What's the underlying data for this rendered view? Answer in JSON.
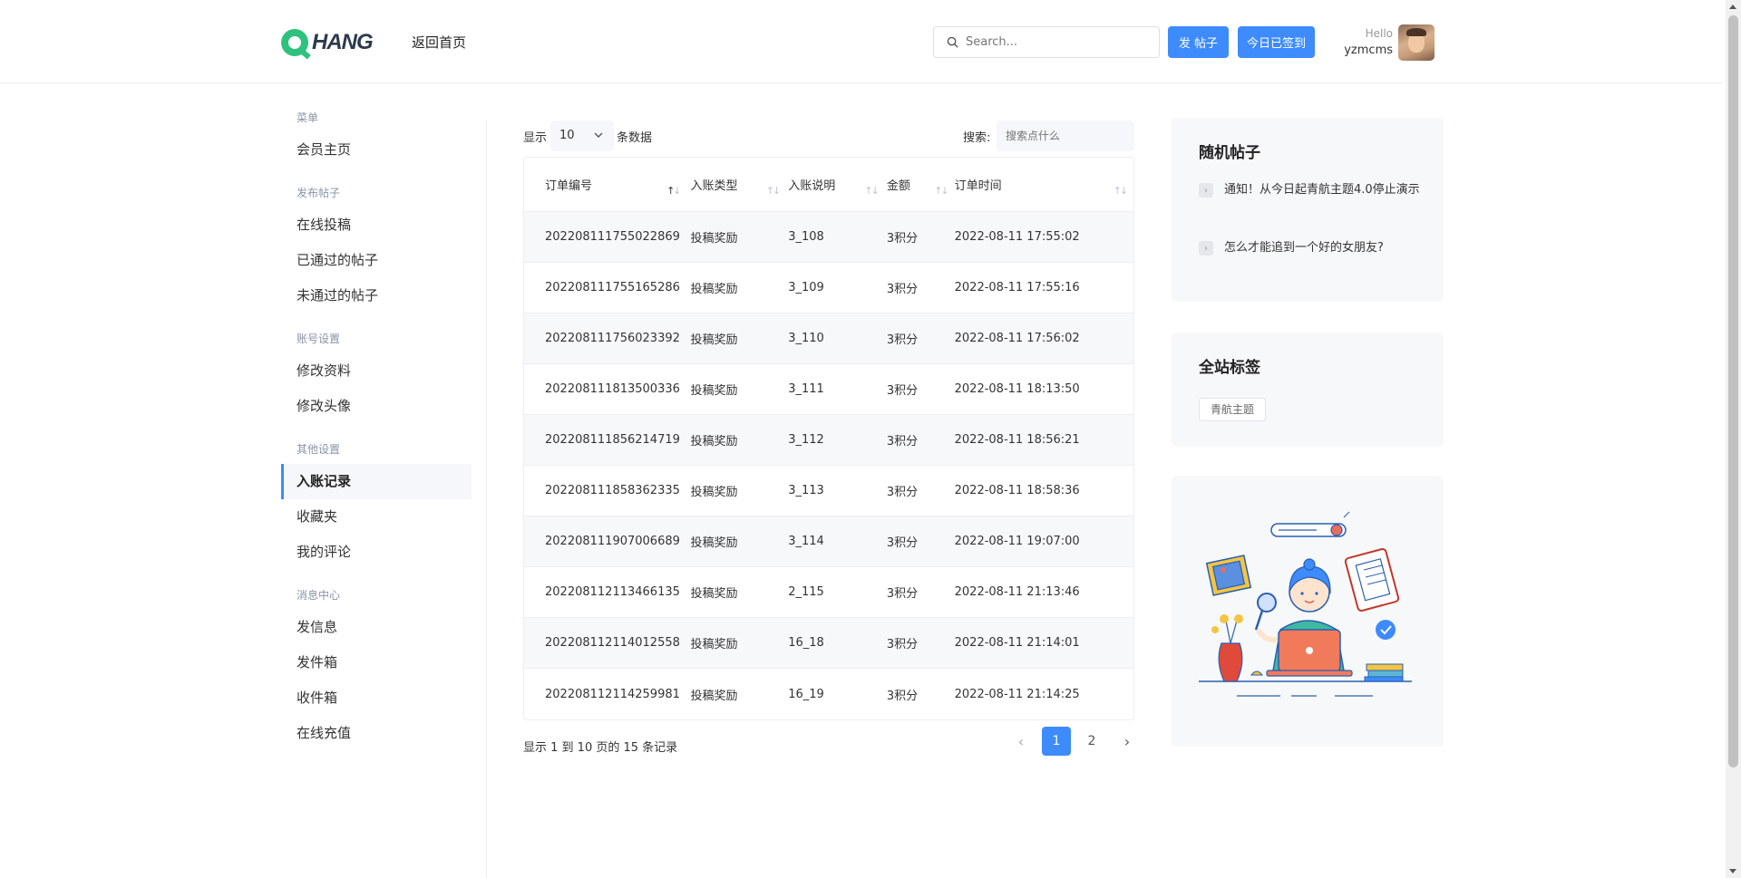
{
  "header": {
    "logo_text": "HANG",
    "back_home": "返回首页",
    "search_placeholder": "Search...",
    "post_button": "发 帖子",
    "signin_button": "今日已签到",
    "hello": "Hello",
    "username": "yzmcms"
  },
  "sidebar": {
    "groups": [
      {
        "title": "菜单",
        "items": [
          "会员主页"
        ]
      },
      {
        "title": "发布帖子",
        "items": [
          "在线投稿",
          "已通过的帖子",
          "未通过的帖子"
        ]
      },
      {
        "title": "账号设置",
        "items": [
          "修改资料",
          "修改头像"
        ]
      },
      {
        "title": "其他设置",
        "items": [
          "入账记录",
          "收藏夹",
          "我的评论"
        ]
      },
      {
        "title": "消息中心",
        "items": [
          "发信息",
          "发件箱",
          "收件箱",
          "在线充值"
        ]
      }
    ],
    "active_item": "入账记录"
  },
  "table_controls": {
    "show_label": "显示",
    "page_size": "10",
    "rows_label": "条数据",
    "search_label": "搜索:",
    "search_placeholder": "搜索点什么"
  },
  "table": {
    "columns": [
      "订单编号",
      "入账类型",
      "入账说明",
      "金额",
      "订单时间"
    ],
    "rows": [
      [
        "202208111755022869",
        "投稿奖励",
        "3_108",
        "3积分",
        "2022-08-11 17:55:02"
      ],
      [
        "202208111755165286",
        "投稿奖励",
        "3_109",
        "3积分",
        "2022-08-11 17:55:16"
      ],
      [
        "202208111756023392",
        "投稿奖励",
        "3_110",
        "3积分",
        "2022-08-11 17:56:02"
      ],
      [
        "202208111813500336",
        "投稿奖励",
        "3_111",
        "3积分",
        "2022-08-11 18:13:50"
      ],
      [
        "202208111856214719",
        "投稿奖励",
        "3_112",
        "3积分",
        "2022-08-11 18:56:21"
      ],
      [
        "202208111858362335",
        "投稿奖励",
        "3_113",
        "3积分",
        "2022-08-11 18:58:36"
      ],
      [
        "202208111907006689",
        "投稿奖励",
        "3_114",
        "3积分",
        "2022-08-11 19:07:00"
      ],
      [
        "202208112113466135",
        "投稿奖励",
        "2_115",
        "3积分",
        "2022-08-11 21:13:46"
      ],
      [
        "202208112114012558",
        "投稿奖励",
        "16_18",
        "3积分",
        "2022-08-11 21:14:01"
      ],
      [
        "202208112114259981",
        "投稿奖励",
        "16_19",
        "3积分",
        "2022-08-11 21:14:25"
      ]
    ],
    "info": "显示 1 到 10 页的 15 条记录"
  },
  "pagination": {
    "pages": [
      "1",
      "2"
    ],
    "current": "1",
    "prev": "‹",
    "next": "›"
  },
  "random_posts": {
    "title": "随机帖子",
    "items": [
      "通知！从今日起青航主题4.0停止演示",
      "怎么才能追到一个好的女朋友?"
    ]
  },
  "tags": {
    "title": "全站标签",
    "items": [
      "青航主题"
    ]
  },
  "colors": {
    "primary": "#3d8bfd",
    "logo_green": "#2ec27e",
    "card_bg": "#f7f8fa"
  }
}
